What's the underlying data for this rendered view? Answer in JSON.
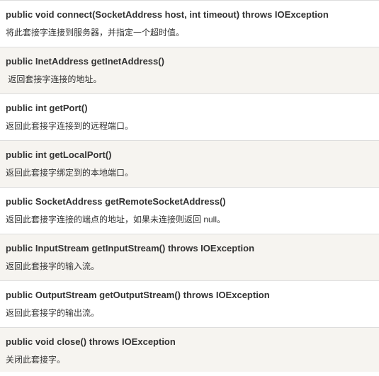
{
  "methods": [
    {
      "signature": "public void connect(SocketAddress host, int timeout) throws IOException",
      "description": "将此套接字连接到服务器，并指定一个超时值。"
    },
    {
      "signature": "public InetAddress getInetAddress()",
      "description": " 返回套接字连接的地址。"
    },
    {
      "signature": "public int getPort()",
      "description": "返回此套接字连接到的远程端口。"
    },
    {
      "signature": "public int getLocalPort()",
      "description": "返回此套接字绑定到的本地端口。"
    },
    {
      "signature": "public SocketAddress getRemoteSocketAddress()",
      "description": "返回此套接字连接的端点的地址，如果未连接则返回 null。"
    },
    {
      "signature": "public InputStream getInputStream() throws IOException",
      "description": "返回此套接字的输入流。"
    },
    {
      "signature": "public OutputStream getOutputStream() throws IOException",
      "description": "返回此套接字的输出流。"
    },
    {
      "signature": "public void close() throws IOException",
      "description": "关闭此套接字。"
    }
  ]
}
